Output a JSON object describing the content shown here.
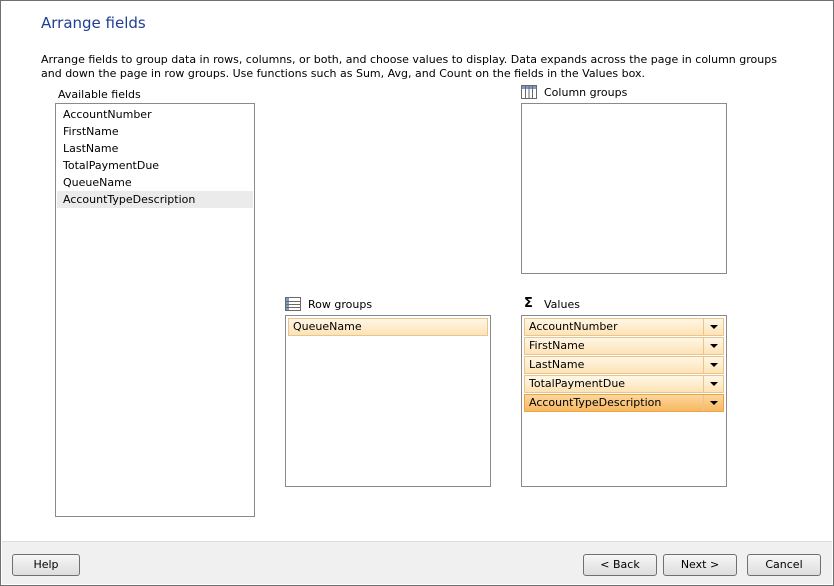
{
  "page": {
    "title": "Arrange fields",
    "description": "Arrange fields to group data in rows, columns, or both, and choose values to display. Data expands across the page in column groups and down the page in row groups.  Use functions such as Sum, Avg, and Count on the fields in the Values box."
  },
  "available_fields": {
    "label": "Available fields",
    "items": [
      "AccountNumber",
      "FirstName",
      "LastName",
      "TotalPaymentDue",
      "QueueName",
      "AccountTypeDescription"
    ],
    "selected_index": 5
  },
  "column_groups": {
    "label": "Column groups",
    "items": []
  },
  "row_groups": {
    "label": "Row groups",
    "items": [
      "QueueName"
    ]
  },
  "values": {
    "label": "Values",
    "items": [
      "AccountNumber",
      "FirstName",
      "LastName",
      "TotalPaymentDue",
      "AccountTypeDescription"
    ],
    "active_index": 4
  },
  "buttons": {
    "help": "Help",
    "back": "< Back",
    "next": "Next >",
    "cancel": "Cancel"
  },
  "icons": {
    "column_groups": "table-columns-icon",
    "row_groups": "table-rows-icon",
    "values": "sigma-icon"
  },
  "colors": {
    "title": "#1e3f93",
    "chip": "#fde3b5",
    "chip_active": "#f7b861"
  }
}
